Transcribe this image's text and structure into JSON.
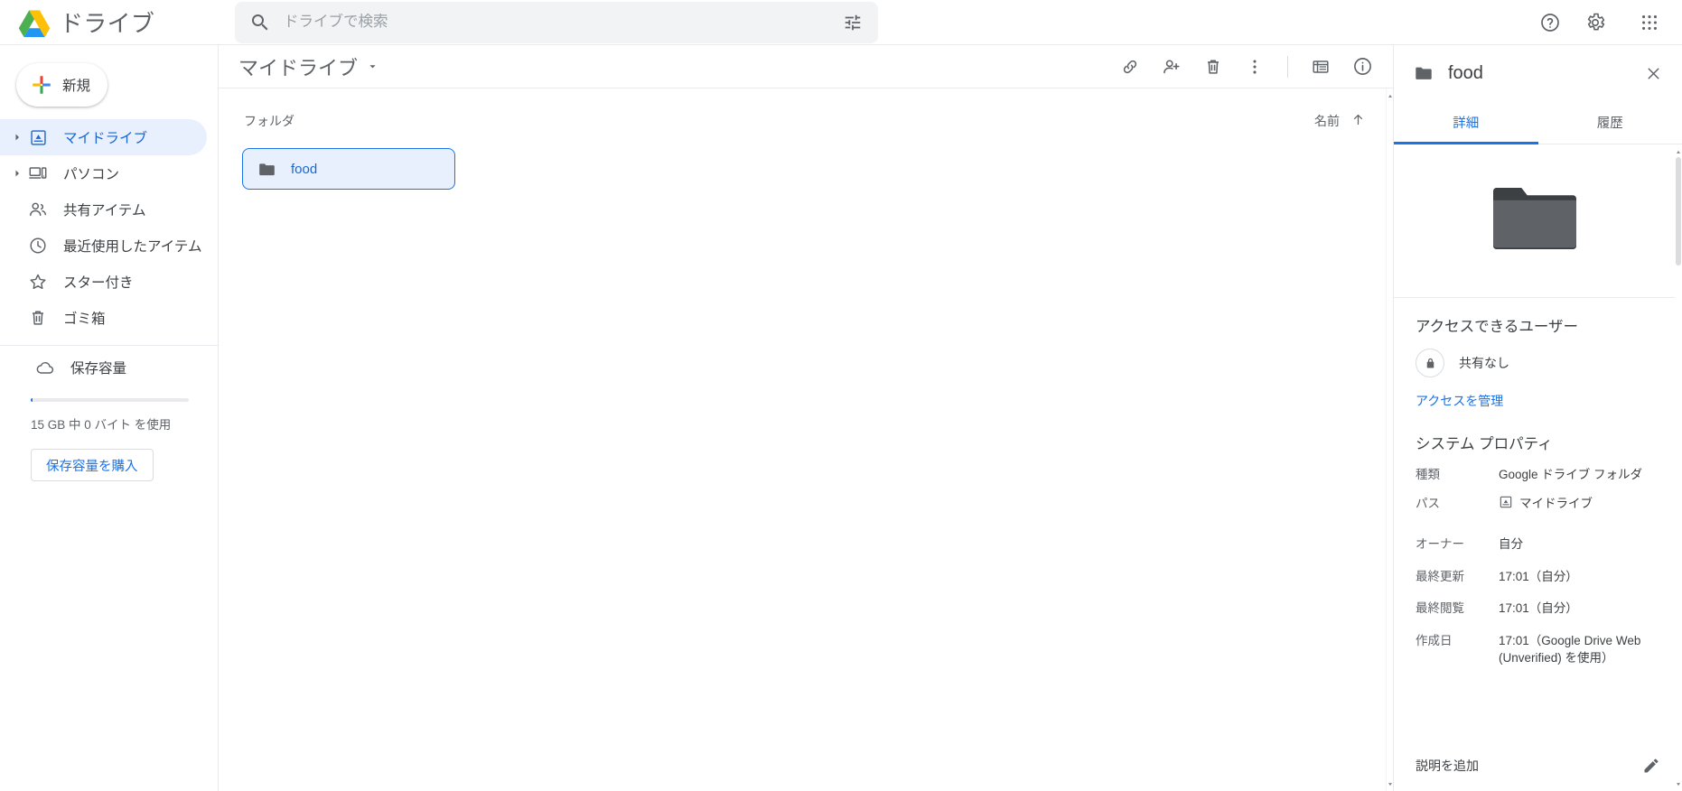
{
  "header": {
    "brand_name": "ドライブ",
    "logo_icon": "drive-logo",
    "search": {
      "icon": "search-icon",
      "placeholder": "ドライブで検索",
      "value": "",
      "filter_icon": "tune-icon"
    },
    "actions": [
      {
        "name": "help-button",
        "icon": "help-icon"
      },
      {
        "name": "settings-button",
        "icon": "gear-icon"
      },
      {
        "name": "google-apps-button",
        "icon": "apps-grid-icon"
      }
    ]
  },
  "sidebar": {
    "new_button": {
      "label": "新規",
      "icon": "plus-icon"
    },
    "items": [
      {
        "label": "マイドライブ",
        "icon": "my-drive-icon",
        "expandable": true,
        "active": true
      },
      {
        "label": "パソコン",
        "icon": "computer-icon",
        "expandable": true,
        "active": false
      },
      {
        "label": "共有アイテム",
        "icon": "people-icon",
        "expandable": false,
        "active": false
      },
      {
        "label": "最近使用したアイテム",
        "icon": "clock-icon",
        "expandable": false,
        "active": false
      },
      {
        "label": "スター付き",
        "icon": "star-icon",
        "expandable": false,
        "active": false
      },
      {
        "label": "ゴミ箱",
        "icon": "trash-icon",
        "expandable": false,
        "active": false
      }
    ],
    "storage": {
      "label": "保存容量",
      "icon": "cloud-icon",
      "usage_text": "15 GB 中 0 バイト を使用",
      "used_percent": 1,
      "buy_label": "保存容量を購入"
    }
  },
  "main": {
    "breadcrumb": {
      "label": "マイドライブ",
      "dropdown_icon": "chevron-down-icon"
    },
    "toolbar": [
      {
        "name": "get-link-button",
        "icon": "link-icon"
      },
      {
        "name": "share-button",
        "icon": "person-add-icon"
      },
      {
        "name": "remove-button",
        "icon": "trash-icon"
      },
      {
        "name": "more-actions-button",
        "icon": "more-vert-icon"
      },
      {
        "name": "list-view-button",
        "icon": "list-view-icon"
      },
      {
        "name": "details-button",
        "icon": "info-icon"
      }
    ],
    "section_title": "フォルダ",
    "sort": {
      "label": "名前",
      "direction_icon": "arrow-up-icon"
    },
    "folders": [
      {
        "name": "food",
        "icon": "folder-icon",
        "selected": true
      }
    ]
  },
  "details": {
    "title": "food",
    "icon": "folder-icon",
    "close_icon": "close-icon",
    "tabs": [
      {
        "label": "詳細",
        "active": true
      },
      {
        "label": "履歴",
        "active": false
      }
    ],
    "preview_icon": "folder-large-icon",
    "access": {
      "heading": "アクセスできるユーザー",
      "lock_icon": "lock-icon",
      "status": "共有なし",
      "manage_link": "アクセスを管理"
    },
    "system_properties": {
      "heading": "システム プロパティ",
      "rows": [
        {
          "key": "種類",
          "value": "Google ドライブ フォルダ",
          "icon": null
        },
        {
          "key": "パス",
          "value": "マイドライブ",
          "icon": "my-drive-icon"
        }
      ]
    },
    "meta_rows": [
      {
        "key": "オーナー",
        "value": "自分"
      },
      {
        "key": "最終更新",
        "value": "17:01（自分）"
      },
      {
        "key": "最終閲覧",
        "value": "17:01（自分）"
      },
      {
        "key": "作成日",
        "value": "17:01（Google Drive Web (Unverified) を使用）"
      }
    ],
    "description": {
      "placeholder": "説明を追加",
      "edit_icon": "pencil-icon"
    }
  },
  "colors": {
    "accent": "#1a73e8",
    "accent_text": "#1967d2",
    "selected_bg": "#e8f0fe",
    "text": "#3c4043",
    "muted": "#5f6368",
    "folder_gray": "#5f6368"
  }
}
